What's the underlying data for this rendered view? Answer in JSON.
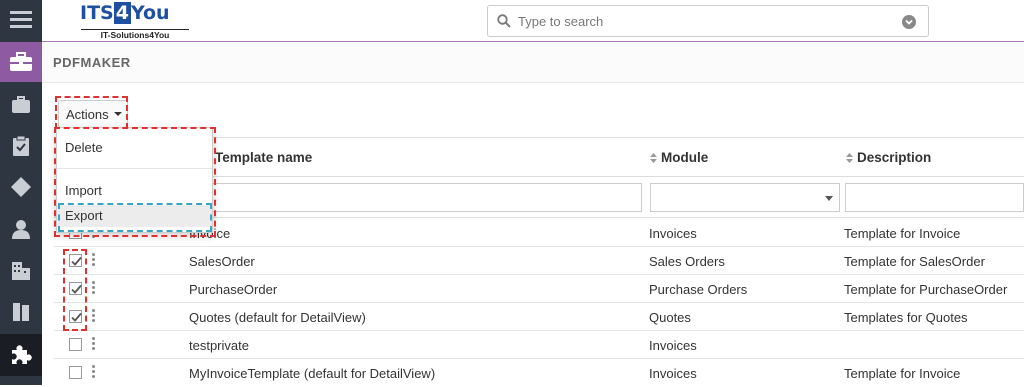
{
  "logo": {
    "main_a": "ITS",
    "main_b": "4",
    "main_c": "You",
    "sub": "IT-Solutions4You"
  },
  "search": {
    "placeholder": "Type to search"
  },
  "module": {
    "title": "PDFMAKER"
  },
  "actions": {
    "label": "Actions",
    "menu": [
      "Delete",
      "Import",
      "Export"
    ]
  },
  "table": {
    "headers": [
      "Template name",
      "Module",
      "Description"
    ],
    "rows": [
      {
        "name": "Invoice",
        "module": "Invoices",
        "description": "Template for Invoice",
        "checked": false
      },
      {
        "name": "SalesOrder",
        "module": "Sales Orders",
        "description": "Template for SalesOrder",
        "checked": true
      },
      {
        "name": "PurchaseOrder",
        "module": "Purchase Orders",
        "description": "Template for PurchaseOrder",
        "checked": true
      },
      {
        "name": "Quotes (default for DetailView)",
        "module": "Quotes",
        "description": "Templates for Quotes",
        "checked": true
      },
      {
        "name": "testprivate",
        "module": "Invoices",
        "description": "",
        "checked": false
      },
      {
        "name": "MyInvoiceTemplate (default for DetailView)",
        "module": "Invoices",
        "description": "Template for Invoice",
        "checked": false
      }
    ]
  },
  "colors": {
    "sidebar": "#2d3641",
    "accent": "#8e5ba3",
    "highlight_red": "#e0302f",
    "highlight_blue": "#3aa3c9"
  },
  "icons": [
    "menu-icon",
    "briefcase-icon",
    "suitcase-icon",
    "clipboard-icon",
    "diamond-icon",
    "user-icon",
    "building-icon",
    "book-icon",
    "puzzle-icon",
    "search-icon",
    "chevron-down-icon",
    "sort-icon",
    "check-icon",
    "drag-handle-icon"
  ]
}
